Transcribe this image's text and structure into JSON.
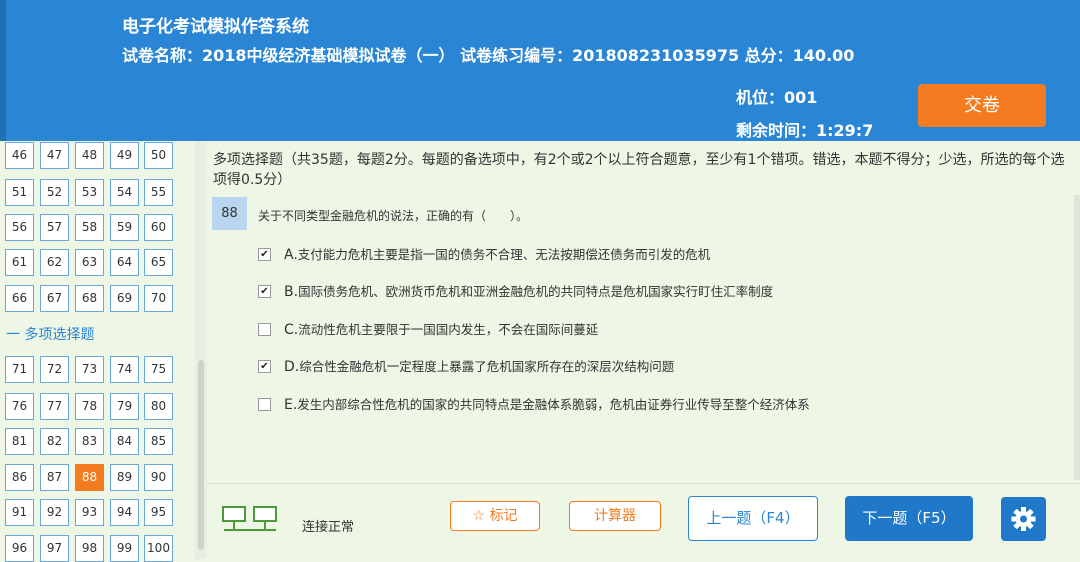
{
  "header": {
    "system_title": "电子化考试模拟作答系统",
    "paper_line": "试卷名称：2018中级经济基础模拟试卷（一） 试卷练习编号：201808231035975 总分：140.00",
    "seat": "机位：001",
    "time_remaining": "剩余时间：1:29:7",
    "submit_label": "交卷"
  },
  "nav": {
    "section_label": "一 多项选择题",
    "rows_top": [
      [
        "46",
        "47",
        "48",
        "49",
        "50"
      ],
      [
        "51",
        "52",
        "53",
        "54",
        "55"
      ],
      [
        "56",
        "57",
        "58",
        "59",
        "60"
      ],
      [
        "61",
        "62",
        "63",
        "64",
        "65"
      ],
      [
        "66",
        "67",
        "68",
        "69",
        "70"
      ]
    ],
    "rows_bottom": [
      [
        "71",
        "72",
        "73",
        "74",
        "75"
      ],
      [
        "76",
        "77",
        "78",
        "79",
        "80"
      ],
      [
        "81",
        "82",
        "83",
        "84",
        "85"
      ],
      [
        "86",
        "87",
        "88",
        "89",
        "90"
      ],
      [
        "91",
        "92",
        "93",
        "94",
        "95"
      ],
      [
        "96",
        "97",
        "98",
        "99",
        "100"
      ]
    ],
    "current": "88"
  },
  "main": {
    "instructions": "多项选择题（共35题，每题2分。每题的备选项中，有2个或2个以上符合题意，至少有1个错项。错选，本题不得分；少选，所选的每个选项得0.5分）",
    "question_number": "88",
    "question_text": "关于不同类型金融危机的说法，正确的有（　　）。",
    "options": [
      {
        "letter": "A.",
        "text": "支付能力危机主要是指一国的债务不合理、无法按期偿还债务而引发的危机",
        "checked": true
      },
      {
        "letter": "B.",
        "text": "国际债务危机、欧洲货币危机和亚洲金融危机的共同特点是危机国家实行盯住汇率制度",
        "checked": true
      },
      {
        "letter": "C.",
        "text": "流动性危机主要限于一国国内发生，不会在国际间蔓延",
        "checked": false
      },
      {
        "letter": "D.",
        "text": "综合性金融危机一定程度上暴露了危机国家所存在的深层次结构问题",
        "checked": true
      },
      {
        "letter": "E.",
        "text": "发生内部综合性危机的国家的共同特点是金融体系脆弱，危机由证券行业传导至整个经济体系",
        "checked": false
      }
    ]
  },
  "footer": {
    "connection_status": "连接正常",
    "mark_label": "☆ 标记",
    "calc_label": "计算器",
    "prev_label": "上一题（F4）",
    "next_label": "下一题（F5）"
  },
  "icons": {
    "network": "network-icon",
    "settings": "gear-icon",
    "mark": "star-icon"
  },
  "colors": {
    "header": "#2a86d4",
    "accent": "#f47b20",
    "background": "#eef6e6"
  }
}
